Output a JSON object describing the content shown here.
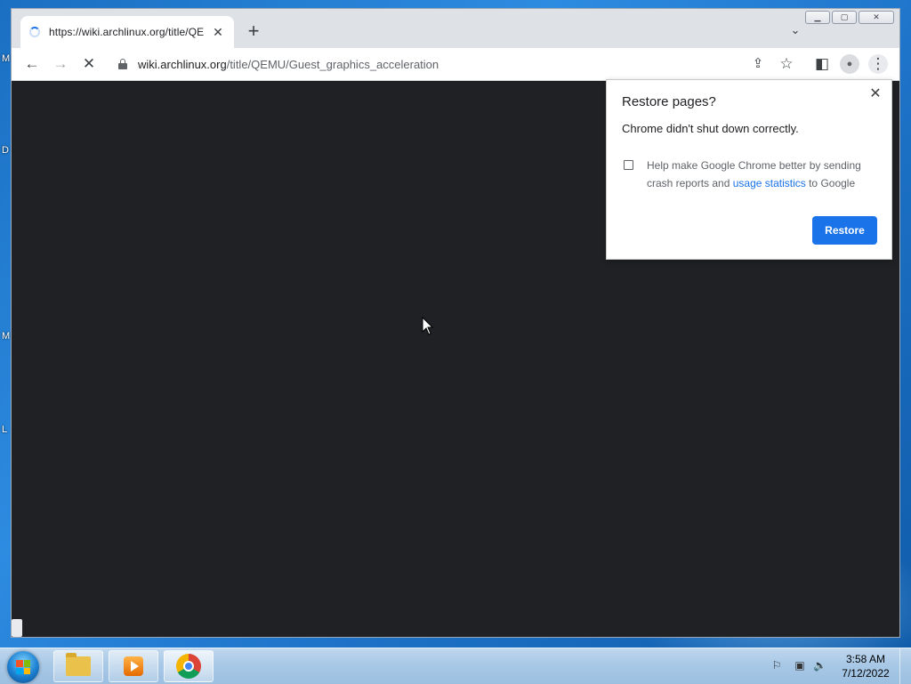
{
  "desktop": {
    "edge_letters": [
      "M",
      "D",
      "M",
      "L"
    ]
  },
  "tab": {
    "title": "https://wiki.archlinux.org/title/QE",
    "close_glyph": "✕"
  },
  "new_tab_glyph": "+",
  "tab_search_glyph": "⌄",
  "window_controls": {
    "minimize": "▁",
    "maximize": "▢",
    "close": "✕"
  },
  "toolbar": {
    "back_glyph": "←",
    "forward_glyph": "→",
    "stop_glyph": "✕",
    "share_glyph": "⇪",
    "bookmark_glyph": "☆",
    "side_panel_glyph": "◧",
    "profile_glyph": "●",
    "menu_glyph": "⋮"
  },
  "omnibox": {
    "host": "wiki.archlinux.org",
    "path": "/title/QEMU/Guest_graphics_acceleration"
  },
  "restore_bubble": {
    "title": "Restore pages?",
    "message": "Chrome didn't shut down correctly.",
    "checkbox_text_before": "Help make Google Chrome better by sending crash reports and ",
    "checkbox_link": "usage statistics",
    "checkbox_text_after": " to Google",
    "restore_label": "Restore",
    "close_glyph": "✕"
  },
  "taskbar": {
    "clock_time": "3:58 AM",
    "clock_date": "7/12/2022",
    "tray_glyphs": [
      "⚐",
      "▣",
      "🔈"
    ]
  }
}
